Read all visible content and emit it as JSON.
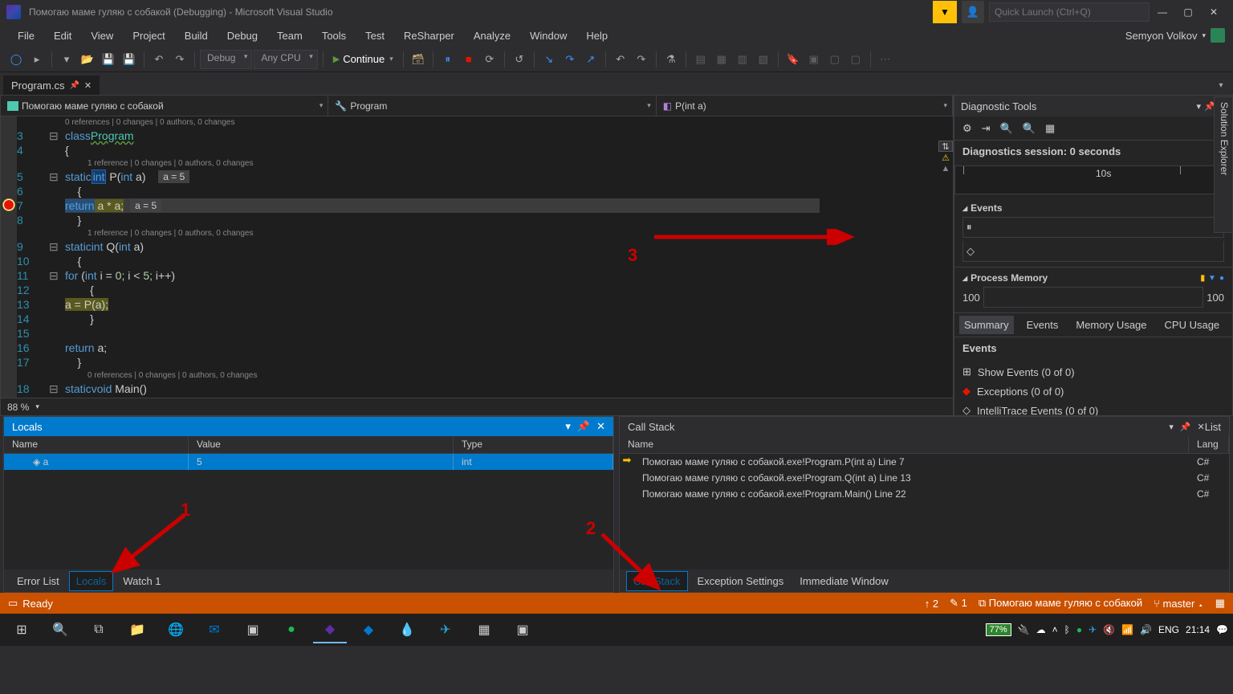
{
  "title": "Помогаю маме гуляю с собакой (Debugging) - Microsoft Visual Studio",
  "quick_launch_placeholder": "Quick Launch (Ctrl+Q)",
  "user_name": "Semyon Volkov",
  "menu": [
    "File",
    "Edit",
    "View",
    "Project",
    "Build",
    "Debug",
    "Team",
    "Tools",
    "Test",
    "ReSharper",
    "Analyze",
    "Window",
    "Help"
  ],
  "toolbar": {
    "config": "Debug",
    "platform": "Any CPU",
    "continue": "Continue"
  },
  "doc_tab": "Program.cs",
  "nav": {
    "namespace": "Помогаю маме гуляю с собакой",
    "class": "Program",
    "member": "P(int a)"
  },
  "code": {
    "codelens1": "0 references | 0 changes | 0 authors, 0 changes",
    "codelens2": "1 reference | 0 changes | 0 authors, 0 changes",
    "lines": {
      "l2": "",
      "l3": "class Program",
      "l4": "{",
      "l5": "    static int P(int a)",
      "l5_tip": "a = 5",
      "l6": "    {",
      "l7_a": "        return",
      "l7_b": " a * a;",
      "l7_tip": "a = 5",
      "l8": "    }",
      "l9": "    static int Q(int a)",
      "l10": "    {",
      "l11": "        for (int i = 0; i < 5; i++)",
      "l12": "        {",
      "l13": "            a = P(a);",
      "l14": "        }",
      "l15": "",
      "l16": "        return a;",
      "l17": "    }",
      "l18": "    static void Main()",
      "l19": "    {"
    }
  },
  "zoom": "88 %",
  "diag": {
    "title": "Diagnostic Tools",
    "session": "Diagnostics session: 0 seconds",
    "time_tick": "10s",
    "events": "Events",
    "memory": "Process Memory",
    "mem_left": "100",
    "mem_right": "100",
    "tabs": [
      "Summary",
      "Events",
      "Memory Usage",
      "CPU Usage"
    ],
    "events_header": "Events",
    "show_events": "Show Events (0 of 0)",
    "exceptions": "Exceptions (0 of 0)",
    "intellitrace": "IntelliTrace Events (0 of 0)"
  },
  "locals": {
    "title": "Locals",
    "cols": [
      "Name",
      "Value",
      "Type"
    ],
    "row": {
      "name": "a",
      "value": "5",
      "type": "int"
    },
    "tabs": [
      "Error List",
      "Locals",
      "Watch 1"
    ]
  },
  "callstack": {
    "title": "Call Stack",
    "cols": [
      "Name",
      "Lang"
    ],
    "rows": [
      {
        "name": "Помогаю маме гуляю с собакой.exe!Program.P(int a) Line 7",
        "lang": "C#"
      },
      {
        "name": "Помогаю маме гуляю с собакой.exe!Program.Q(int a) Line 13",
        "lang": "C#"
      },
      {
        "name": "Помогаю маме гуляю с собакой.exe!Program.Main() Line 22",
        "lang": "C#"
      }
    ],
    "tabs": [
      "Call Stack",
      "Exception Settings",
      "Immediate Window"
    ]
  },
  "status": {
    "ready": "Ready",
    "up": "2",
    "edit": "1",
    "project": "Помогаю маме гуляю с собакой",
    "branch": "master"
  },
  "taskbar": {
    "battery": "77%",
    "lang": "ENG",
    "time": "21:14"
  },
  "solution_explorer": "Solution Explorer",
  "annotations": {
    "a1": "1",
    "a2": "2",
    "a3": "3"
  }
}
